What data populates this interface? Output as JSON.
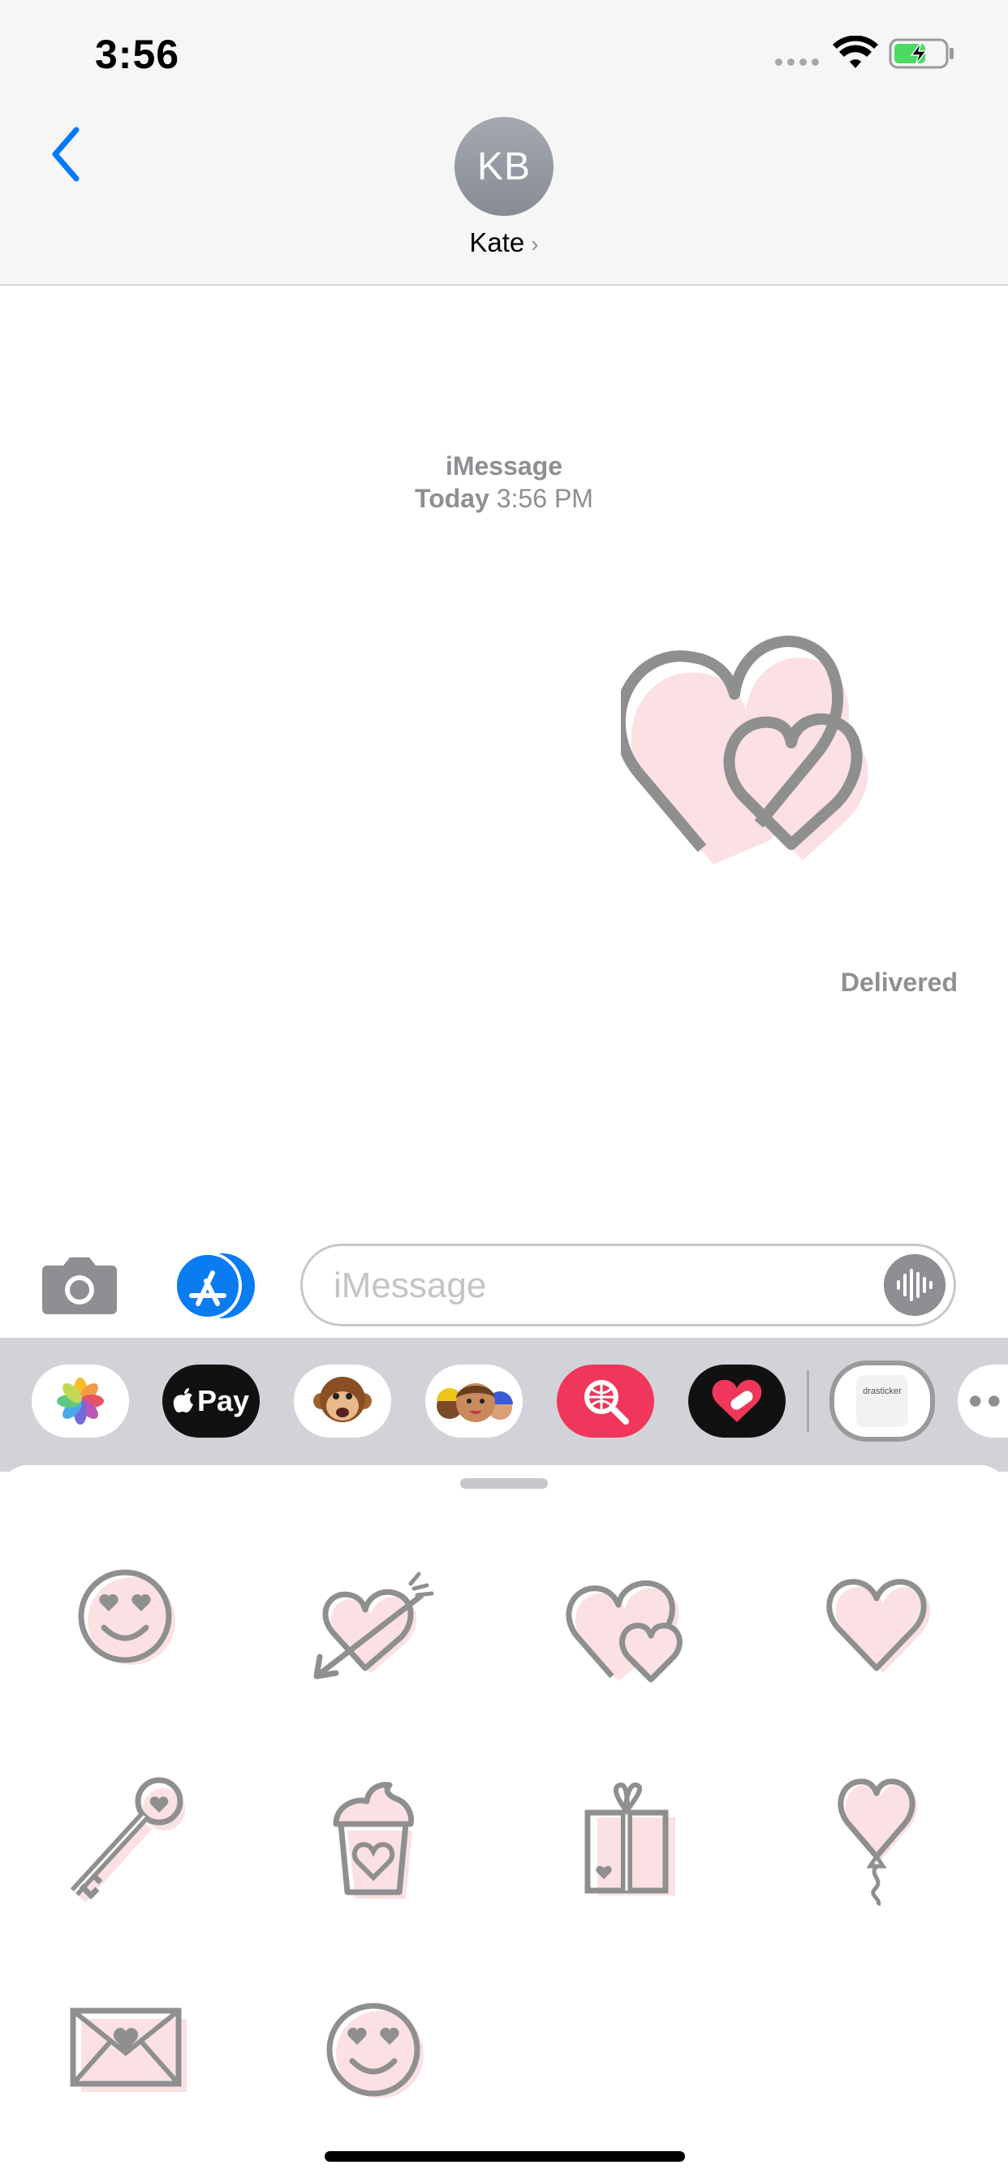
{
  "status_bar": {
    "time": "3:56",
    "battery_state": "charging"
  },
  "header": {
    "back_icon": "chevron-left-icon",
    "avatar_initials": "KB",
    "contact_name": "Kate",
    "contact_chevron": "›"
  },
  "conversation": {
    "service": "iMessage",
    "timestamp_day": "Today",
    "timestamp_time": "3:56 PM",
    "message": {
      "type": "sticker",
      "sticker_icon": "double-hearts-icon"
    },
    "status": "Delivered"
  },
  "input_bar": {
    "camera_icon": "camera-icon",
    "apps_icon": "app-store-icon",
    "placeholder": "iMessage",
    "audio_icon": "waveform-icon"
  },
  "app_strip": {
    "apps": [
      {
        "name": "Photos",
        "icon": "photos-icon"
      },
      {
        "name": "Apple Pay",
        "label": "Pay",
        "icon": "apple-pay-icon"
      },
      {
        "name": "Animoji",
        "icon": "monkey-icon"
      },
      {
        "name": "Memoji",
        "icon": "memoji-icon"
      },
      {
        "name": "Images",
        "icon": "image-search-icon"
      },
      {
        "name": "Digital Touch",
        "icon": "heart-touch-icon"
      },
      {
        "name": "dra sticker",
        "label": "drasticker",
        "icon": "drasticker-icon"
      },
      {
        "name": "More",
        "icon": "more-icon"
      }
    ]
  },
  "sticker_drawer": {
    "stickers": [
      {
        "name": "Heart eyes face",
        "icon": "heart-eyes-face-icon"
      },
      {
        "name": "Heart with arrow",
        "icon": "heart-arrow-icon"
      },
      {
        "name": "Double hearts",
        "icon": "double-hearts-icon"
      },
      {
        "name": "Heart",
        "icon": "heart-icon"
      },
      {
        "name": "Heart key",
        "icon": "key-icon"
      },
      {
        "name": "Cupcake",
        "icon": "cupcake-icon"
      },
      {
        "name": "Gift box",
        "icon": "gift-icon"
      },
      {
        "name": "Heart balloon",
        "icon": "balloon-icon"
      },
      {
        "name": "Love letter",
        "icon": "envelope-icon"
      },
      {
        "name": "Heart eyes face 2",
        "icon": "heart-eyes-face-icon"
      }
    ]
  },
  "colors": {
    "accent": "#007aff",
    "sticker_outline": "#8f8f8f",
    "sticker_fill": "#fbe1e3",
    "strip_bg": "#d1d3d9"
  }
}
